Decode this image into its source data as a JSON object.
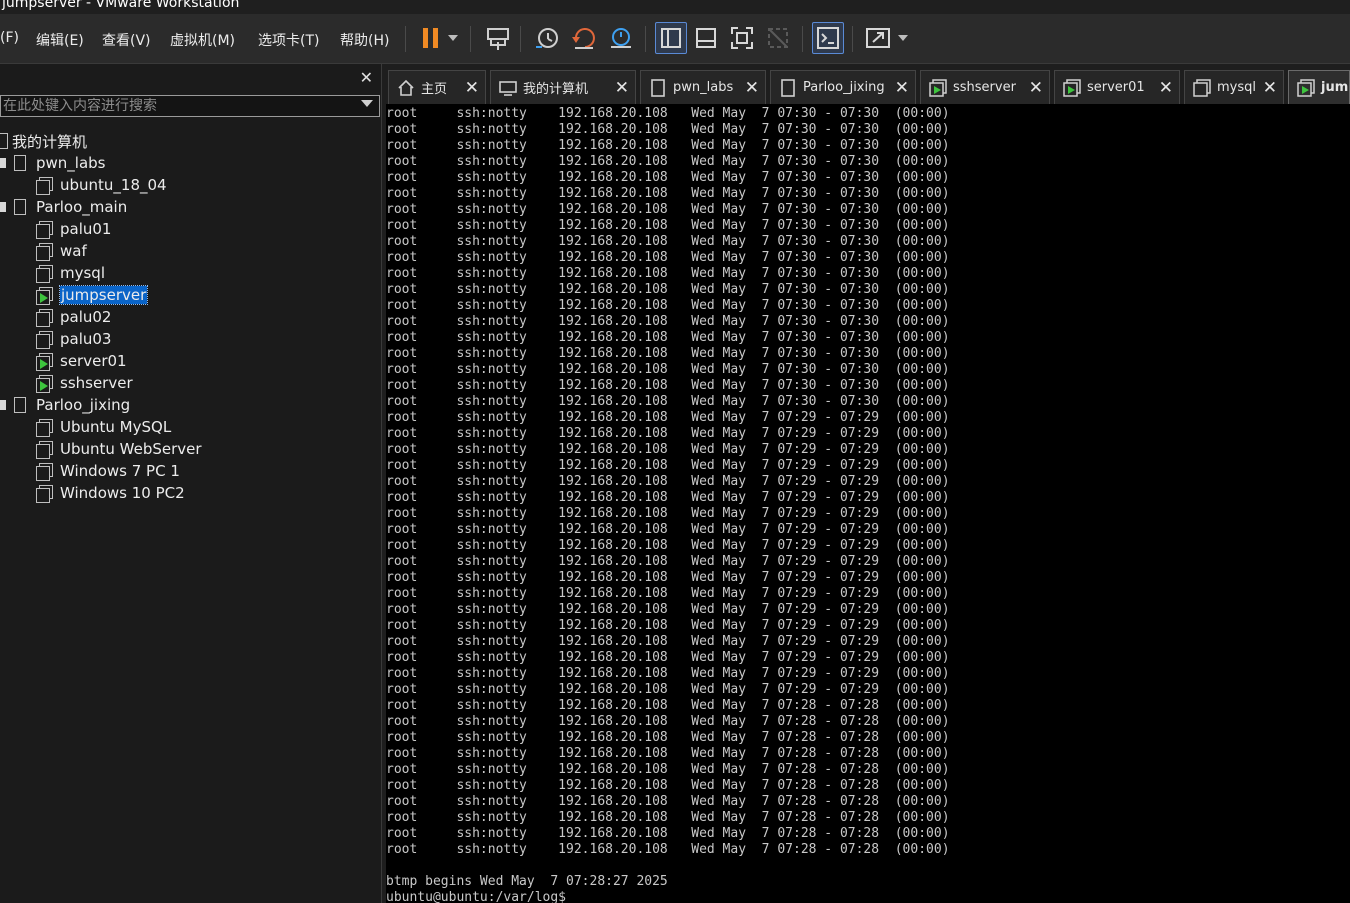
{
  "window": {
    "title": "jumpserver - VMware Workstation"
  },
  "menu": [
    {
      "label": "(F)"
    },
    {
      "label": "编辑(E)"
    },
    {
      "label": "查看(V)"
    },
    {
      "label": "虚拟机(M)"
    },
    {
      "label": "选项卡(T)"
    },
    {
      "label": "帮助(H)"
    }
  ],
  "toolbar": {
    "icons": [
      "pause-icon",
      "dropdown-arrow-icon",
      "send-ctrl-alt-del-icon",
      "snapshot-take-icon",
      "snapshot-revert-icon",
      "snapshot-manager-icon",
      "library-view-icon",
      "thumbnail-view-icon",
      "full-screen-icon",
      "unity-icon",
      "console-view-icon",
      "stretch-guest-icon",
      "dropdown-arrow-icon"
    ],
    "accent": "#f08a24"
  },
  "sidebar": {
    "close_label": "✕",
    "search_placeholder": "在此处键入内容进行搜索",
    "tree": [
      {
        "label": "我的计算机",
        "icon": "computer-icon",
        "level": 0,
        "expander": false
      },
      {
        "label": "pwn_labs",
        "icon": "folder-icon",
        "level": 1,
        "expander": true
      },
      {
        "label": "ubuntu_18_04",
        "icon": "vm-icon",
        "level": 2,
        "running": false
      },
      {
        "label": "Parloo_main",
        "icon": "folder-icon",
        "level": 1,
        "expander": true
      },
      {
        "label": "palu01",
        "icon": "vm-icon",
        "level": 2,
        "running": false
      },
      {
        "label": "waf",
        "icon": "vm-icon",
        "level": 2,
        "running": false
      },
      {
        "label": "mysql",
        "icon": "vm-icon",
        "level": 2,
        "running": false
      },
      {
        "label": "jumpserver",
        "icon": "vm-icon",
        "level": 2,
        "running": true,
        "selected": true
      },
      {
        "label": "palu02",
        "icon": "vm-icon",
        "level": 2,
        "running": false
      },
      {
        "label": "palu03",
        "icon": "vm-icon",
        "level": 2,
        "running": false
      },
      {
        "label": "server01",
        "icon": "vm-icon",
        "level": 2,
        "running": true
      },
      {
        "label": "sshserver",
        "icon": "vm-icon",
        "level": 2,
        "running": true
      },
      {
        "label": "Parloo_jixing",
        "icon": "folder-icon",
        "level": 1,
        "expander": true
      },
      {
        "label": "Ubuntu MySQL",
        "icon": "vm-icon",
        "level": 2,
        "running": false
      },
      {
        "label": "Ubuntu WebServer",
        "icon": "vm-icon",
        "level": 2,
        "running": false
      },
      {
        "label": "Windows 7 PC 1",
        "icon": "vm-icon",
        "level": 2,
        "running": false
      },
      {
        "label": "Windows 10 PC2",
        "icon": "vm-icon",
        "level": 2,
        "running": false
      }
    ]
  },
  "tabs": [
    {
      "label": "主页",
      "icon": "home-icon",
      "close": "✕"
    },
    {
      "label": "我的计算机",
      "icon": "computer-icon",
      "close": "✕"
    },
    {
      "label": "pwn_labs",
      "icon": "folder-icon",
      "close": "✕"
    },
    {
      "label": "Parloo_jixing",
      "icon": "folder-icon",
      "close": "✕"
    },
    {
      "label": "sshserver",
      "icon": "vm-running-icon",
      "close": "✕"
    },
    {
      "label": "server01",
      "icon": "vm-running-icon",
      "close": "✕"
    },
    {
      "label": "mysql",
      "icon": "vm-icon",
      "close": "✕"
    },
    {
      "label": "jump",
      "icon": "vm-running-icon",
      "active": true
    }
  ],
  "terminal": {
    "lines": [
      "root     ssh:notty    192.168.20.108   Wed May  7 07:30 - 07:30  (00:00)",
      "root     ssh:notty    192.168.20.108   Wed May  7 07:30 - 07:30  (00:00)",
      "root     ssh:notty    192.168.20.108   Wed May  7 07:30 - 07:30  (00:00)",
      "root     ssh:notty    192.168.20.108   Wed May  7 07:30 - 07:30  (00:00)",
      "root     ssh:notty    192.168.20.108   Wed May  7 07:30 - 07:30  (00:00)",
      "root     ssh:notty    192.168.20.108   Wed May  7 07:30 - 07:30  (00:00)",
      "root     ssh:notty    192.168.20.108   Wed May  7 07:30 - 07:30  (00:00)",
      "root     ssh:notty    192.168.20.108   Wed May  7 07:30 - 07:30  (00:00)",
      "root     ssh:notty    192.168.20.108   Wed May  7 07:30 - 07:30  (00:00)",
      "root     ssh:notty    192.168.20.108   Wed May  7 07:30 - 07:30  (00:00)",
      "root     ssh:notty    192.168.20.108   Wed May  7 07:30 - 07:30  (00:00)",
      "root     ssh:notty    192.168.20.108   Wed May  7 07:30 - 07:30  (00:00)",
      "root     ssh:notty    192.168.20.108   Wed May  7 07:30 - 07:30  (00:00)",
      "root     ssh:notty    192.168.20.108   Wed May  7 07:30 - 07:30  (00:00)",
      "root     ssh:notty    192.168.20.108   Wed May  7 07:30 - 07:30  (00:00)",
      "root     ssh:notty    192.168.20.108   Wed May  7 07:30 - 07:30  (00:00)",
      "root     ssh:notty    192.168.20.108   Wed May  7 07:30 - 07:30  (00:00)",
      "root     ssh:notty    192.168.20.108   Wed May  7 07:30 - 07:30  (00:00)",
      "root     ssh:notty    192.168.20.108   Wed May  7 07:30 - 07:30  (00:00)",
      "root     ssh:notty    192.168.20.108   Wed May  7 07:29 - 07:29  (00:00)",
      "root     ssh:notty    192.168.20.108   Wed May  7 07:29 - 07:29  (00:00)",
      "root     ssh:notty    192.168.20.108   Wed May  7 07:29 - 07:29  (00:00)",
      "root     ssh:notty    192.168.20.108   Wed May  7 07:29 - 07:29  (00:00)",
      "root     ssh:notty    192.168.20.108   Wed May  7 07:29 - 07:29  (00:00)",
      "root     ssh:notty    192.168.20.108   Wed May  7 07:29 - 07:29  (00:00)",
      "root     ssh:notty    192.168.20.108   Wed May  7 07:29 - 07:29  (00:00)",
      "root     ssh:notty    192.168.20.108   Wed May  7 07:29 - 07:29  (00:00)",
      "root     ssh:notty    192.168.20.108   Wed May  7 07:29 - 07:29  (00:00)",
      "root     ssh:notty    192.168.20.108   Wed May  7 07:29 - 07:29  (00:00)",
      "root     ssh:notty    192.168.20.108   Wed May  7 07:29 - 07:29  (00:00)",
      "root     ssh:notty    192.168.20.108   Wed May  7 07:29 - 07:29  (00:00)",
      "root     ssh:notty    192.168.20.108   Wed May  7 07:29 - 07:29  (00:00)",
      "root     ssh:notty    192.168.20.108   Wed May  7 07:29 - 07:29  (00:00)",
      "root     ssh:notty    192.168.20.108   Wed May  7 07:29 - 07:29  (00:00)",
      "root     ssh:notty    192.168.20.108   Wed May  7 07:29 - 07:29  (00:00)",
      "root     ssh:notty    192.168.20.108   Wed May  7 07:29 - 07:29  (00:00)",
      "root     ssh:notty    192.168.20.108   Wed May  7 07:29 - 07:29  (00:00)",
      "root     ssh:notty    192.168.20.108   Wed May  7 07:28 - 07:28  (00:00)",
      "root     ssh:notty    192.168.20.108   Wed May  7 07:28 - 07:28  (00:00)",
      "root     ssh:notty    192.168.20.108   Wed May  7 07:28 - 07:28  (00:00)",
      "root     ssh:notty    192.168.20.108   Wed May  7 07:28 - 07:28  (00:00)",
      "root     ssh:notty    192.168.20.108   Wed May  7 07:28 - 07:28  (00:00)",
      "root     ssh:notty    192.168.20.108   Wed May  7 07:28 - 07:28  (00:00)",
      "root     ssh:notty    192.168.20.108   Wed May  7 07:28 - 07:28  (00:00)",
      "root     ssh:notty    192.168.20.108   Wed May  7 07:28 - 07:28  (00:00)",
      "root     ssh:notty    192.168.20.108   Wed May  7 07:28 - 07:28  (00:00)",
      "root     ssh:notty    192.168.20.108   Wed May  7 07:28 - 07:28  (00:00)",
      "",
      "btmp begins Wed May  7 07:28:27 2025",
      "ubuntu@ubuntu:/var/log$ _"
    ]
  }
}
